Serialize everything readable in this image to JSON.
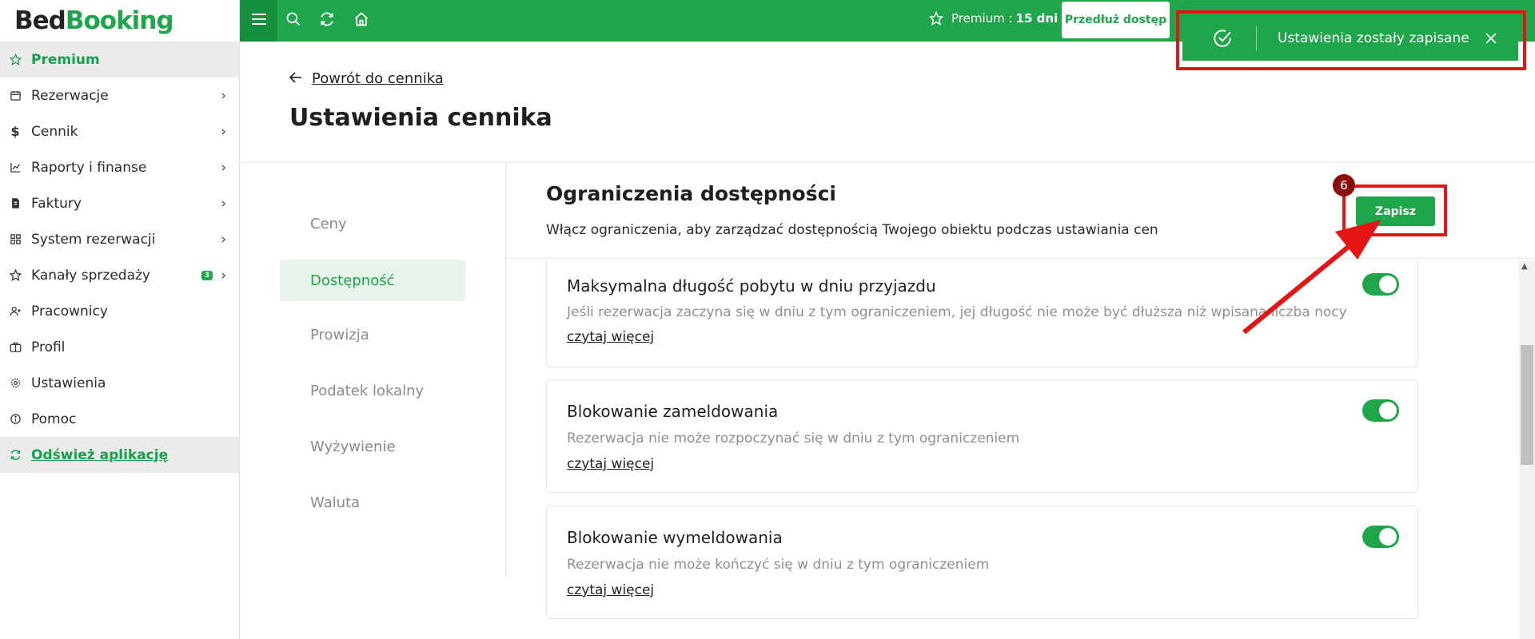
{
  "brand": {
    "part1": "Bed",
    "part2": "Booking"
  },
  "sidebar": {
    "items": [
      {
        "label": "Premium",
        "icon": "star-icon"
      },
      {
        "label": "Rezerwacje",
        "icon": "calendar-icon"
      },
      {
        "label": "Cennik",
        "icon": "dollar-icon"
      },
      {
        "label": "Raporty i finanse",
        "icon": "chart-icon"
      },
      {
        "label": "Faktury",
        "icon": "invoice-icon"
      },
      {
        "label": "System rezerwacji",
        "icon": "grid-icon"
      },
      {
        "label": "Kanały sprzedaży",
        "icon": "star-icon",
        "badge": "3"
      },
      {
        "label": "Pracownicy",
        "icon": "user-plus-icon"
      },
      {
        "label": "Profil",
        "icon": "briefcase-icon"
      },
      {
        "label": "Ustawienia",
        "icon": "gear-icon"
      },
      {
        "label": "Pomoc",
        "icon": "info-icon"
      },
      {
        "label": "Odśwież aplikację",
        "icon": "refresh-icon"
      }
    ]
  },
  "topbar": {
    "premium_label": "Premium :",
    "premium_days": "15 dni",
    "extend_label": "Przedłuż dostęp"
  },
  "toast": {
    "message": "Ustawienia zostały zapisane"
  },
  "header": {
    "back_label": "Powrót do cennika",
    "title": "Ustawienia cennika"
  },
  "subnav": [
    "Ceny",
    "Dostępność",
    "Prowizja",
    "Podatek lokalny",
    "Wyżywienie",
    "Waluta"
  ],
  "section": {
    "title": "Ograniczenia dostępności",
    "description": "Włącz ograniczenia, aby zarządzać dostępnością Twojego obiektu podczas ustawiania cen",
    "save_label": "Zapisz",
    "step_number": "6"
  },
  "cards": [
    {
      "title": "Maksymalna długość pobytu w dniu przyjazdu",
      "description": "Jeśli rezerwacja zaczyna się w dniu z tym ograniczeniem, jej długość nie może być dłuższa niż wpisana liczba nocy",
      "link": "czytaj więcej",
      "enabled": true
    },
    {
      "title": "Blokowanie zameldowania",
      "description": "Rezerwacja nie może rozpoczynać się w dniu z tym ograniczeniem",
      "link": "czytaj więcej",
      "enabled": true
    },
    {
      "title": "Blokowanie wymeldowania",
      "description": "Rezerwacja nie może kończyć się w dniu z tym ograniczeniem",
      "link": "czytaj więcej",
      "enabled": true
    }
  ],
  "colors": {
    "accent": "#1fa64a",
    "highlight": "#e51515",
    "badge": "#8b0e0e"
  }
}
